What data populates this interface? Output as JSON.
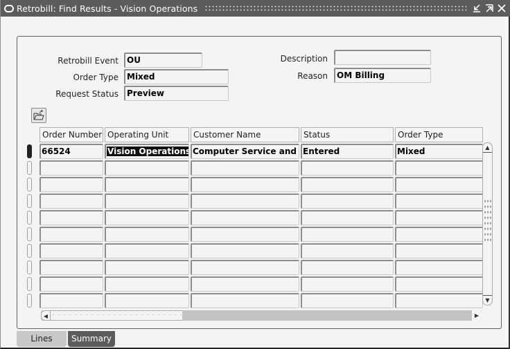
{
  "window": {
    "title": "Retrobill: Find Results - Vision Operations",
    "controls": [
      "minimize",
      "maximize",
      "close"
    ]
  },
  "header": {
    "retrobill_event": {
      "label": "Retrobill Event",
      "value": "OU"
    },
    "order_type": {
      "label": "Order Type",
      "value": "Mixed"
    },
    "request_status": {
      "label": "Request Status",
      "value": "Preview"
    },
    "description": {
      "label": "Description",
      "value": ""
    },
    "reason": {
      "label": "Reason",
      "value": "OM Billing"
    }
  },
  "toolbar": {
    "open_folder_icon": "open-folder-icon"
  },
  "table": {
    "columns": [
      "Order Number",
      "Operating Unit",
      "Customer Name",
      "Status",
      "Order Type"
    ],
    "rows": [
      [
        "66524",
        "Vision Operations",
        "Computer Service and Rentals",
        "Entered",
        "Mixed"
      ],
      [
        "",
        "",
        "",
        "",
        ""
      ],
      [
        "",
        "",
        "",
        "",
        ""
      ],
      [
        "",
        "",
        "",
        "",
        ""
      ],
      [
        "",
        "",
        "",
        "",
        ""
      ],
      [
        "",
        "",
        "",
        "",
        ""
      ],
      [
        "",
        "",
        "",
        "",
        ""
      ],
      [
        "",
        "",
        "",
        "",
        ""
      ],
      [
        "",
        "",
        "",
        "",
        ""
      ],
      [
        "",
        "",
        "",
        "",
        ""
      ]
    ],
    "selected_row": 0,
    "selected_cell_column": 1
  },
  "tabs": [
    {
      "label": "Lines",
      "active": false
    },
    {
      "label": "Summary",
      "active": true
    }
  ]
}
